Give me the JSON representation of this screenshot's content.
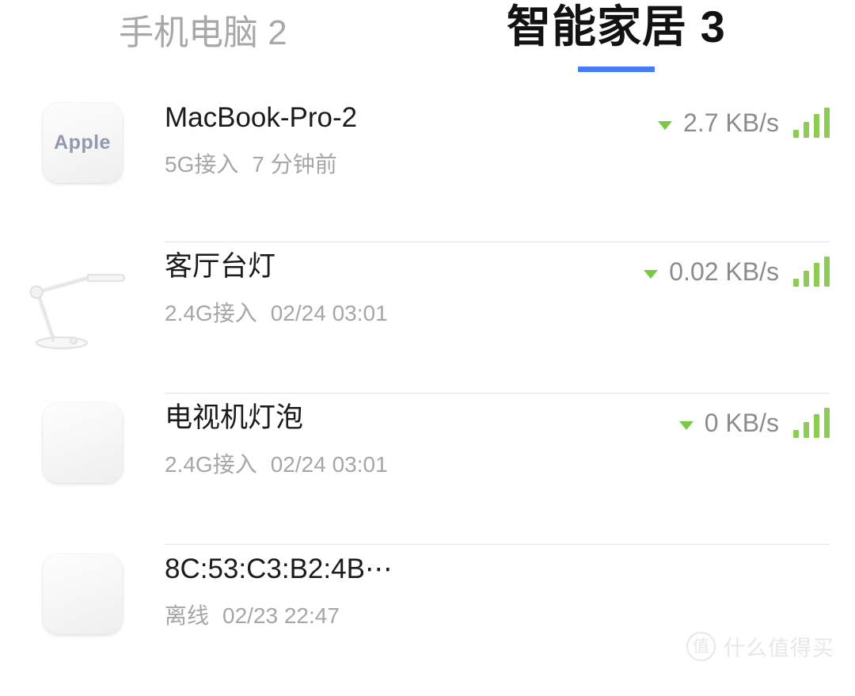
{
  "tabs": [
    {
      "label": "手机电脑",
      "count": "2",
      "active": false
    },
    {
      "label": "智能家居",
      "count": "3",
      "active": true
    }
  ],
  "accent_color": "#4a7bf7",
  "signal_color": "#8ccc55",
  "devices": [
    {
      "icon": "apple-tile-icon",
      "icon_text": "Apple",
      "name": "MacBook-Pro-2",
      "connection": "5G接入",
      "time": "7 分钟前",
      "speed": "2.7 KB/s",
      "direction": "down",
      "signal_bars": 4,
      "online": true
    },
    {
      "icon": "desk-lamp-icon",
      "icon_text": "",
      "name": "客厅台灯",
      "connection": "2.4G接入",
      "time": "02/24 03:01",
      "speed": "0.02 KB/s",
      "direction": "down",
      "signal_bars": 4,
      "online": true
    },
    {
      "icon": "blank-tile-icon",
      "icon_text": "",
      "name": "电视机灯泡",
      "connection": "2.4G接入",
      "time": "02/24 03:01",
      "speed": "0 KB/s",
      "direction": "down",
      "signal_bars": 4,
      "online": true
    },
    {
      "icon": "blank-tile-icon",
      "icon_text": "",
      "name": "8C:53:C3:B2:4B⋯",
      "connection": "离线",
      "time": "02/23 22:47",
      "speed": "",
      "direction": "",
      "signal_bars": 0,
      "online": false
    }
  ],
  "watermark": {
    "badge": "值",
    "text": "什么值得买"
  }
}
